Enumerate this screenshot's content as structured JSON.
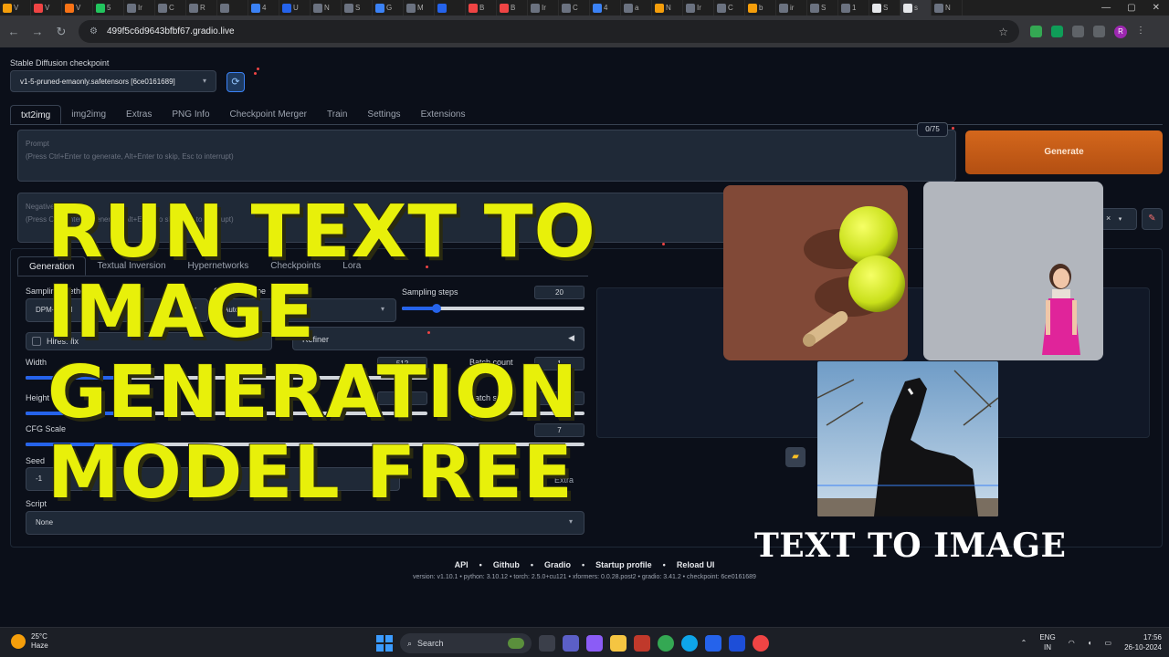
{
  "browser": {
    "tabs": [
      "V",
      "V",
      "V",
      "5",
      "Ir",
      "C",
      "R",
      "",
      "4",
      "U",
      "N",
      "S",
      "G",
      "M",
      "",
      "B",
      "B",
      "Ir",
      "C",
      "4",
      "a",
      "N",
      "Ir",
      "C",
      "b",
      "ir",
      "S",
      "1",
      "S",
      "s",
      "N"
    ],
    "url": "499f5c6d9643bfbf67.gradio.live",
    "profile_initial": "R"
  },
  "app": {
    "checkpoint_label": "Stable Diffusion checkpoint",
    "checkpoint_value": "v1-5-pruned-emaonly.safetensors [6ce0161689]",
    "main_tabs": [
      "txt2img",
      "img2img",
      "Extras",
      "PNG Info",
      "Checkpoint Merger",
      "Train",
      "Settings",
      "Extensions"
    ],
    "prompt_placeholder_1": "Prompt",
    "prompt_placeholder_2": "(Press Ctrl+Enter to generate, Alt+Enter to skip, Esc to interrupt)",
    "token_count": "0/75",
    "generate_label": "Generate",
    "neg_placeholder_1": "Negative prompt",
    "neg_placeholder_2": "(Press Ctrl+Enter to generate, Alt+Enter to skip, Esc to interrupt)",
    "styles_clear": "×",
    "gen_tabs": [
      "Generation",
      "Textual Inversion",
      "Hypernetworks",
      "Checkpoints",
      "Lora"
    ],
    "sampling_method_label": "Sampling method",
    "sampling_method_value": "DPM++ 2M",
    "schedule_label": "Schedule type",
    "schedule_value": "Automatic",
    "sampling_steps_label": "Sampling steps",
    "sampling_steps": "20",
    "sampling_steps_frac": 0.19,
    "hires_label": "Hires. fix",
    "refiner_label": "Refiner",
    "width_label": "Width",
    "width_value": "512",
    "width_frac": 0.25,
    "height_label": "Height",
    "height_value": "512",
    "height_frac": 0.25,
    "batch_count_label": "Batch count",
    "batch_count": "1",
    "batch_size_label": "Batch size",
    "batch_size": "1",
    "cfg_label": "CFG Scale",
    "cfg_value": "7",
    "cfg_frac": 0.22,
    "seed_label": "Seed",
    "seed_value": "-1",
    "extra_label": "Extra",
    "script_label": "Script",
    "script_value": "None"
  },
  "footer": {
    "links": [
      "API",
      "Github",
      "Gradio",
      "Startup profile",
      "Reload UI"
    ],
    "version_line": "version: v1.10.1  •  python: 3.10.12  •  torch: 2.5.0+cu121  •  xformers: 0.0.28.post2  •  gradio: 3.41.2  •  checkpoint: 6ce0161689"
  },
  "overlay": {
    "headline": [
      "RUN TEXT TO",
      "IMAGE",
      "GENERATION",
      "MODEL FREE"
    ],
    "caption": "TEXT TO IMAGE",
    "headline_color": "#e8f00a"
  },
  "taskbar": {
    "temperature": "25°C",
    "weather": "Haze",
    "search_label": "Search",
    "lang_1": "ENG",
    "lang_2": "IN",
    "time": "17:56",
    "date": "26-10-2024"
  }
}
